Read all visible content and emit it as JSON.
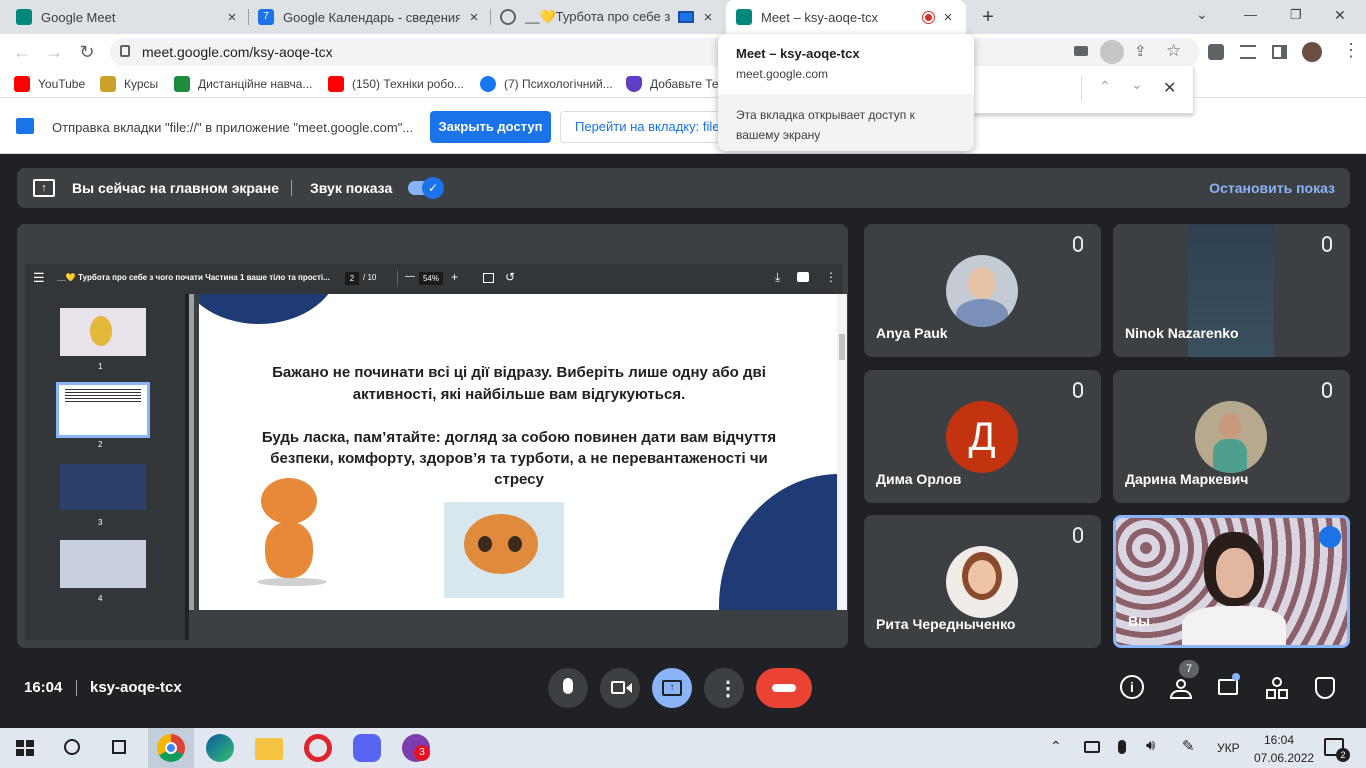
{
  "tabs": [
    {
      "title": "Google Meet",
      "color": "#00897b"
    },
    {
      "title": "Google Календарь - сведения о",
      "color": "#1a73e8"
    },
    {
      "title": "__💛Турбота про себе з чо",
      "color": "#5f6368"
    },
    {
      "title": "Meet – ksy-aoqe-tcx",
      "color": "#00897b"
    }
  ],
  "new_tab": "+",
  "window": {
    "min": "—",
    "restore": "❐",
    "close": "✕",
    "chevron": "⌄"
  },
  "url": "meet.google.com/ksy-aoqe-tcx",
  "bookmarks": [
    {
      "label": "YouTube",
      "color": "#ff0000"
    },
    {
      "label": "Курсы",
      "color": "#c9a227"
    },
    {
      "label": "Дистанційне навча...",
      "color": "#1e8e3e"
    },
    {
      "label": "(150) Техніки робо...",
      "color": "#ff0000"
    },
    {
      "label": "(7) Психологічний...",
      "color": "#1877f2"
    },
    {
      "label": "Добавьте Те",
      "color": "#5f3dc4"
    }
  ],
  "infobar": {
    "text": "Отправка вкладки \"file://\" в приложение \"meet.google.com\"...",
    "share_button": "Закрыть доступ",
    "switch_button": "Перейти на вкладку: file:/"
  },
  "popup": {
    "title": "Meet – ksy-aoqe-tcx",
    "host": "meet.google.com",
    "note": "Эта вкладка открывает доступ к вашему экрану"
  },
  "sharebar": {
    "status": "Вы сейчас на главном экране",
    "sound_label": "Звук показа",
    "stop": "Остановить показ"
  },
  "pdf": {
    "title": "__💛 Турбота про себе з чого почати Частина 1 ваше тіло та прості...",
    "page": "2",
    "pages": "/ 10",
    "zoom": "54%",
    "minus": "—",
    "plus": "+",
    "thumbs": [
      "1",
      "2",
      "3",
      "4"
    ],
    "para1": "Бажано не починати всі ці дії відразу. Виберіть лише одну або дві активності, які найбільше вам відгукуються.",
    "para2": "Будь ласка, пам’ятайте: догляд за собою повинен дати вам відчуття безпеки, комфорту, здоров’я та турботи, а не перевантаженості чи стресу"
  },
  "participants": [
    {
      "name": "Anya Pauk"
    },
    {
      "name": "Ninok Nazarenko"
    },
    {
      "name": "Дима Орлов",
      "initial": "Д"
    },
    {
      "name": "Дарина Маркевич"
    },
    {
      "name": "Рита Чередныченко"
    },
    {
      "name": "Вы"
    }
  ],
  "footer": {
    "time": "16:04",
    "code": "ksy-aoqe-tcx",
    "people_count": "7"
  },
  "taskbar": {
    "lang": "УКР",
    "time": "16:04",
    "date": "07.06.2022",
    "viber_badge": "3",
    "notif": "2"
  }
}
